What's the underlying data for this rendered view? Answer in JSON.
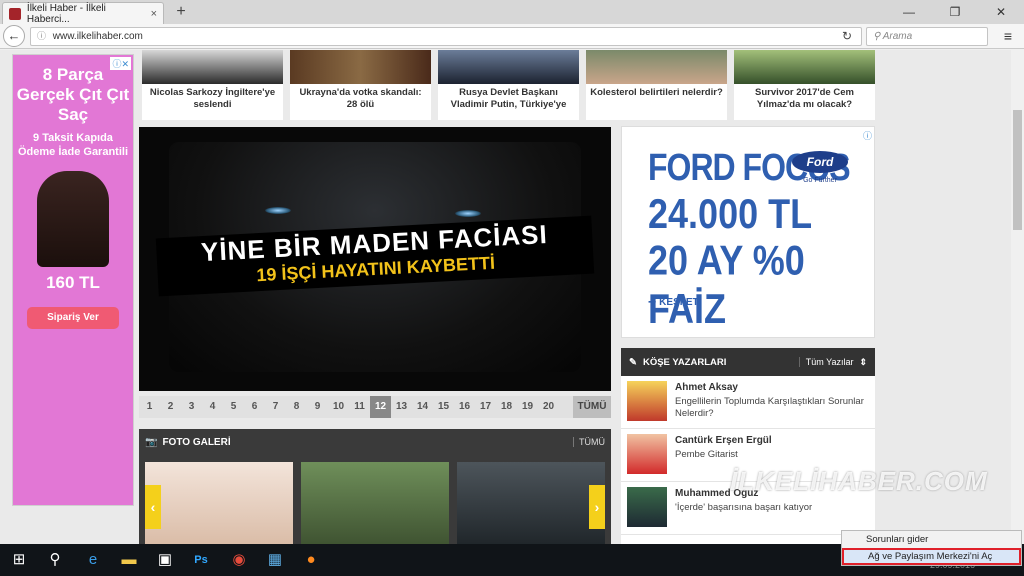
{
  "browser": {
    "tab_title": "İlkeli Haber - İlkeli Haberci...",
    "tab_close": "×",
    "new_tab": "+",
    "url": "www.ilkelihaber.com",
    "search_placeholder": "Arama",
    "back": "←",
    "reload": "↻",
    "menu": "≡",
    "minimize": "—",
    "maximize": "❐",
    "close": "✕"
  },
  "left_ad": {
    "line1": "8 Parça Gerçek Çıt Çıt Saç",
    "line2": "9 Taksit Kapıda Ödeme İade Garantili",
    "price": "160 TL",
    "cta": "Sipariş Ver",
    "adchoice": "ⓘ✕"
  },
  "top_news": [
    {
      "caption": "Nicolas Sarkozy İngiltere'ye seslendi"
    },
    {
      "caption": "Ukrayna'da votka skandalı: 28 ölü"
    },
    {
      "caption": "Rusya Devlet Başkanı Vladimir Putin, Türkiye'ye"
    },
    {
      "caption": "Kolesterol belirtileri nelerdir?"
    },
    {
      "caption": "Survivor 2017'de Cem Yılmaz'da mı olacak?"
    }
  ],
  "slider": {
    "headline1": "YİNE BİR MADEN FACİASI",
    "headline2": "19 İŞÇİ HAYATINI KAYBETTİ",
    "pages": [
      "1",
      "2",
      "3",
      "4",
      "5",
      "6",
      "7",
      "8",
      "9",
      "10",
      "11",
      "12",
      "13",
      "14",
      "15",
      "16",
      "17",
      "18",
      "19",
      "20"
    ],
    "active_page": "12",
    "all_label": "TÜMÜ"
  },
  "gallery": {
    "title": "FOTO GALERİ",
    "more": "TÜMÜ",
    "prev": "‹",
    "next": "›"
  },
  "right_ad": {
    "model": "FORD FOCUS",
    "price": "24.000 TL",
    "offer": "20 AY %0 FAİZ",
    "brand": "Ford",
    "slogan": "Go Further",
    "cta": "KEŞFET",
    "adchoice": "ⓘ"
  },
  "columnists": {
    "title": "KÖŞE YAZARLARI",
    "filter": "Tüm Yazılar",
    "items": [
      {
        "name": "Ahmet Aksay",
        "title": "Engellilerin Toplumda Karşılaştıkları Sorunlar Nelerdir?"
      },
      {
        "name": "Cantürk Erşen Ergül",
        "title": "Pembe Gitarist"
      },
      {
        "name": "Muhammed Oğuz",
        "title": "'İçerde' başarısına başarı katıyor"
      }
    ]
  },
  "watermark": "İLKELİHABER.COM",
  "context_menu": {
    "item1": "Sorunları gider",
    "item2": "Ağ ve Paylaşım Merkezi'ni Aç"
  },
  "taskbar": {
    "date": "29.09.2016"
  }
}
